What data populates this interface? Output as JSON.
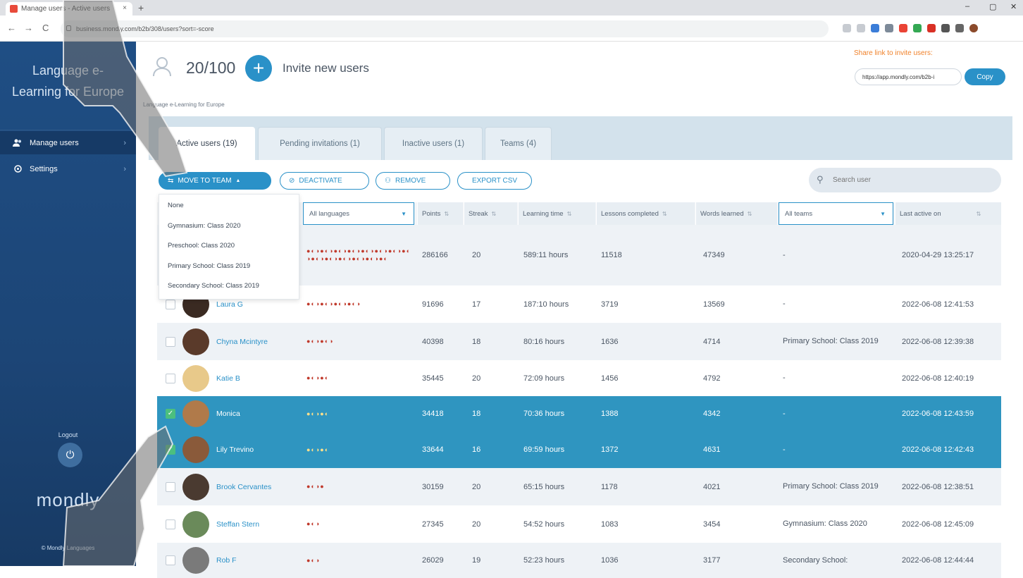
{
  "browser": {
    "tab_title": "Manage users - Active users",
    "tab_close": "×",
    "new_tab": "+",
    "url": "business.mondly.com/b2b/308/users?sort=-score",
    "win_min": "–",
    "win_max": "▢",
    "win_close": "✕",
    "back": "←",
    "forward": "→",
    "reload": "C"
  },
  "sidebar": {
    "org_name_line1": "Language e-",
    "org_name_line2": "Learning for Europe",
    "items": [
      {
        "label": "Manage users",
        "icon": "users-icon"
      },
      {
        "label": "Settings",
        "icon": "settings-icon"
      }
    ],
    "chevron": "›",
    "logout_label": "Logout",
    "logout_glyph": "⏻",
    "brand": "mondly",
    "copyright": "© Mondly Languages"
  },
  "header": {
    "user_count": "20/100",
    "invite_plus": "+",
    "invite_label": "Invite new users",
    "org_breadcrumb": "Language e-Learning for Europe",
    "share_label": "Share link to invite users:",
    "share_url": "https://app.mondly.com/b2b-i",
    "copy_label": "Copy"
  },
  "tabs": [
    {
      "label": "Active users (19)"
    },
    {
      "label": "Pending invitations (1)"
    },
    {
      "label": "Inactive users (1)"
    },
    {
      "label": "Teams (4)"
    }
  ],
  "actions": {
    "move_to_team": "MOVE TO TEAM",
    "move_caret": "▲",
    "deactivate": "DEACTIVATE",
    "remove": "REMOVE",
    "export_csv": "EXPORT CSV",
    "search_placeholder": "Search user",
    "search_glyph": "⚲"
  },
  "team_menu": {
    "options": [
      "None",
      "Gymnasium: Class 2020",
      "Preschool: Class 2020",
      "Primary School: Class 2019",
      "Secondary School: Class 2019"
    ]
  },
  "columns": {
    "languages_filter": "All languages",
    "points": "Points",
    "streak": "Streak",
    "learning_time": "Learning time",
    "lessons_completed": "Lessons completed",
    "words_learned": "Words learned",
    "teams_filter": "All teams",
    "last_active": "Last active on",
    "sort_glyph": "⇅",
    "caret": "▼"
  },
  "rows": [
    {
      "name": "",
      "checked": false,
      "flags": "●◐◑●◐◑●◐◑●◐◑●◐◑●◐◑●◐◑●◐◑●◐◑●◐◑●◐◑●◐◑●◐◑●◐",
      "points": "286166",
      "streak": "20",
      "time": "589:11 hours",
      "lessons": "11518",
      "words": "47349",
      "team": "-",
      "last": "2020-04-29 13:25:17",
      "avatar": "#b68a6a"
    },
    {
      "name": "Laura G",
      "checked": false,
      "flags": "●◐◑●◐◑●◐◑●◐◑",
      "points": "91696",
      "streak": "17",
      "time": "187:10 hours",
      "lessons": "3719",
      "words": "13569",
      "team": "-",
      "last": "2022-06-08 12:41:53",
      "avatar": "#3a2a22"
    },
    {
      "name": "Chyna Mcintyre",
      "checked": false,
      "flags": "●◐◑●◐◑",
      "points": "40398",
      "streak": "18",
      "time": "80:16 hours",
      "lessons": "1636",
      "words": "4714",
      "team": "Primary School: Class 2019",
      "last": "2022-06-08 12:39:38",
      "avatar": "#5a3a2a"
    },
    {
      "name": "Katie B",
      "checked": false,
      "flags": "●◐◑●◐",
      "points": "35445",
      "streak": "20",
      "time": "72:09 hours",
      "lessons": "1456",
      "words": "4792",
      "team": "-",
      "last": "2022-06-08 12:40:19",
      "avatar": "#e8c98a"
    },
    {
      "name": "Monica",
      "checked": true,
      "flags": "●◐◑●◐",
      "points": "34418",
      "streak": "18",
      "time": "70:36 hours",
      "lessons": "1388",
      "words": "4342",
      "team": "-",
      "last": "2022-06-08 12:43:59",
      "avatar": "#b07a4a"
    },
    {
      "name": "Lily Trevino",
      "checked": true,
      "flags": "●◐◑●◐",
      "points": "33644",
      "streak": "16",
      "time": "69:59 hours",
      "lessons": "1372",
      "words": "4631",
      "team": "-",
      "last": "2022-06-08 12:42:43",
      "avatar": "#8a5a3a"
    },
    {
      "name": "Brook Cervantes",
      "checked": false,
      "flags": "●◐◑●",
      "points": "30159",
      "streak": "20",
      "time": "65:15 hours",
      "lessons": "1178",
      "words": "4021",
      "team": "Primary School: Class 2019",
      "last": "2022-06-08 12:38:51",
      "avatar": "#4a3a30"
    },
    {
      "name": "Steffan Stern",
      "checked": false,
      "flags": "●◐◑",
      "points": "27345",
      "streak": "20",
      "time": "54:52 hours",
      "lessons": "1083",
      "words": "3454",
      "team": "Gymnasium: Class 2020",
      "last": "2022-06-08 12:45:09",
      "avatar": "#6a8a5a"
    },
    {
      "name": "Rob F",
      "checked": false,
      "flags": "●◐◑",
      "points": "26029",
      "streak": "19",
      "time": "52:23 hours",
      "lessons": "1036",
      "words": "3177",
      "team": "Secondary School:",
      "last": "2022-06-08 12:44:44",
      "avatar": "#7a7a7a"
    }
  ],
  "colors": {
    "accent": "#2a91c8",
    "sidebar": "#1f4e84",
    "selected_row": "#2f95c0",
    "share_label": "#f0822b"
  }
}
